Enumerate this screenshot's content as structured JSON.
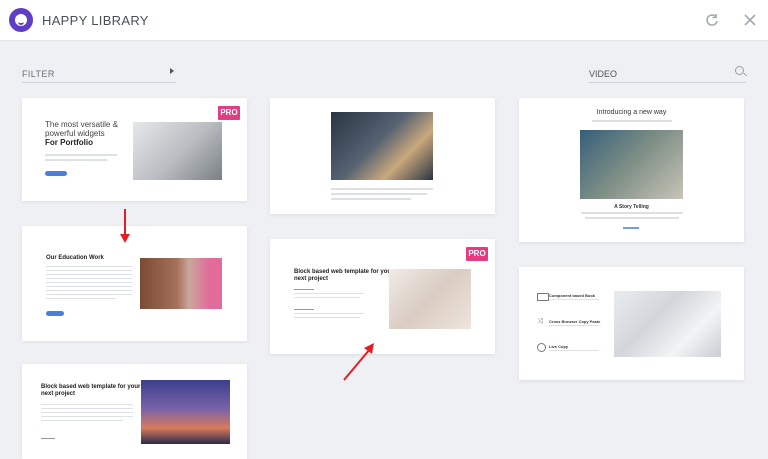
{
  "header": {
    "title": "HAPPY LIBRARY",
    "refresh_icon": "refresh-icon",
    "close_icon": "close-icon"
  },
  "filter": {
    "label": "FILTER"
  },
  "search": {
    "value": "VIDEO"
  },
  "templates": [
    {
      "pro_badge": "PRO",
      "title_lines": [
        "The most versatile &",
        "powerful widgets"
      ],
      "subtitle": "For Portfolio"
    },
    {
      "title": ""
    },
    {
      "title": "Introducing a new way",
      "caption": "A Story Telling"
    },
    {
      "title": "Our Education Work"
    },
    {
      "pro_badge": "PRO",
      "title_lines": [
        "Block based web template for your",
        "next project"
      ]
    },
    {
      "features": [
        "Component based Book",
        "Cross Browser Copy Paste",
        "Live Copy"
      ]
    },
    {
      "title_lines": [
        "Block based web template for your",
        "next project"
      ]
    }
  ],
  "colors": {
    "accent": "#5f3ec6",
    "pro": "#e43c83",
    "annotation_arrow": "#e41d23"
  }
}
